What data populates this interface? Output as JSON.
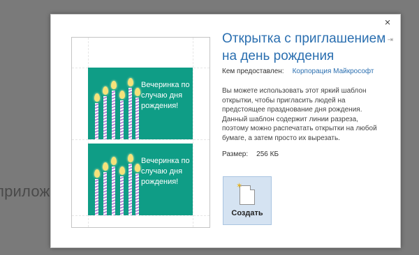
{
  "background": {
    "partial_text": "приложен"
  },
  "dialog": {
    "close_glyph": "×",
    "pin_glyph": "⇥",
    "title": "Открытка с приглашением на день рождения",
    "provider_label": "Кем предоставлен:",
    "provider_value": "Корпорация Майкрософт",
    "description": "Вы можете использовать этот яркий шаблон открытки, чтобы пригласить людей на предстоящее празднование дня рождения. Данный шаблон содержит линии разреза, поэтому можно распечатать открытки на любой бумаге, а затем просто их вырезать.",
    "size_label": "Размер:",
    "size_value": "256 КБ",
    "create_label": "Создать"
  },
  "preview": {
    "card_text_1": "Вечеринка по случаю дня рождения!",
    "card_text_2": "Вечеринка по случаю дня рождения!"
  },
  "colors": {
    "accent": "#2b6fb0",
    "card_green": "#0f9d86",
    "button_bg": "#d5e3f2"
  }
}
